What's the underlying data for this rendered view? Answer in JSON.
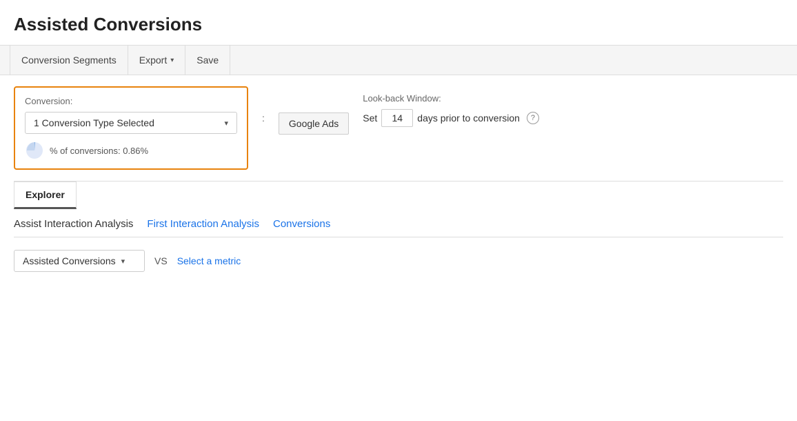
{
  "page": {
    "title": "Assisted Conversions"
  },
  "toolbar": {
    "conversion_segments_label": "Conversion Segments",
    "export_label": "Export",
    "save_label": "Save"
  },
  "filter": {
    "conversion_label": "Conversion:",
    "dropdown_value": "1 Conversion Type Selected",
    "colon": ":",
    "google_ads_label": "Google Ads",
    "percent_text": "% of conversions: 0.86%"
  },
  "lookback": {
    "label": "Look-back Window:",
    "set_label": "Set",
    "days_value": "14",
    "days_text": "days prior to conversion",
    "help_symbol": "?"
  },
  "tabs": [
    {
      "label": "Explorer",
      "active": true
    }
  ],
  "analysis_nav": [
    {
      "label": "Assist Interaction Analysis",
      "active": true,
      "link": false
    },
    {
      "label": "First Interaction Analysis",
      "active": false,
      "link": true
    },
    {
      "label": "Conversions",
      "active": false,
      "link": true
    }
  ],
  "metric_row": {
    "metric_label": "Assisted Conversions",
    "vs_text": "VS",
    "select_metric_label": "Select a metric"
  },
  "icons": {
    "chevron_down": "▾",
    "question": "?"
  }
}
